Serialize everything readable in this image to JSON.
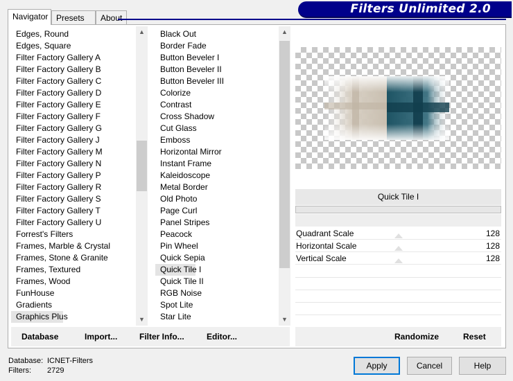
{
  "tabs": [
    {
      "label": "Navigator"
    },
    {
      "label": "Presets"
    },
    {
      "label": "About"
    }
  ],
  "banner": {
    "title": "Filters Unlimited 2.0"
  },
  "categories": {
    "selected": "Graphics Plus",
    "items": [
      "Edges, Round",
      "Edges, Square",
      "Filter Factory Gallery A",
      "Filter Factory Gallery B",
      "Filter Factory Gallery C",
      "Filter Factory Gallery D",
      "Filter Factory Gallery E",
      "Filter Factory Gallery F",
      "Filter Factory Gallery G",
      "Filter Factory Gallery J",
      "Filter Factory Gallery M",
      "Filter Factory Gallery N",
      "Filter Factory Gallery P",
      "Filter Factory Gallery R",
      "Filter Factory Gallery S",
      "Filter Factory Gallery T",
      "Filter Factory Gallery U",
      "Forrest's Filters",
      "Frames, Marble & Crystal",
      "Frames, Stone & Granite",
      "Frames, Textured",
      "Frames, Wood",
      "FunHouse",
      "Gradients",
      "Graphics Plus"
    ]
  },
  "filters": {
    "selected": "Quick Tile I",
    "items": [
      "Black Out",
      "Border Fade",
      "Button Beveler I",
      "Button Beveler II",
      "Button Beveler III",
      "Colorize",
      "Contrast",
      "Cross Shadow",
      "Cut Glass",
      "Emboss",
      "Horizontal Mirror",
      "Instant Frame",
      "Kaleidoscope",
      "Metal Border",
      "Old Photo",
      "Page Curl",
      "Panel Stripes",
      "Peacock",
      "Pin Wheel",
      "Quick Sepia",
      "Quick Tile I",
      "Quick Tile II",
      "RGB Noise",
      "Spot Lite",
      "Star Lite"
    ]
  },
  "filter_panel": {
    "title": "Quick Tile I",
    "sliders": [
      {
        "label": "Quadrant Scale",
        "value": "128",
        "level": 0.5
      },
      {
        "label": "Horizontal Scale",
        "value": "128",
        "level": 0.5
      },
      {
        "label": "Vertical Scale",
        "value": "128",
        "level": 0.5
      }
    ]
  },
  "buttons": {
    "database": "Database",
    "import": "Import...",
    "filter_info": "Filter Info...",
    "editor": "Editor...",
    "randomize": "Randomize",
    "reset": "Reset",
    "apply": "Apply",
    "cancel": "Cancel",
    "help": "Help"
  },
  "footer": {
    "database_label": "Database:",
    "database_value": "ICNET-Filters",
    "filters_label": "Filters:",
    "filters_value": "2729"
  },
  "colors": {
    "banner": "#00008b",
    "preview_teal": "#1e5464",
    "preview_beige": "#cfc6b8"
  },
  "icons": {
    "scroll_up": "▲",
    "scroll_down": "▼"
  }
}
